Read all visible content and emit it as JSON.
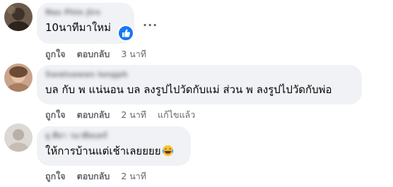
{
  "comments": [
    {
      "author": "Nas Phin Jirs",
      "text": "10นาทีมาใหม่",
      "like_label": "ถูกใจ",
      "reply_label": "ตอบกลับ",
      "time": "3 นาที",
      "edited": "",
      "reaction_icon": "like-icon",
      "more_icon": "ellipsis-icon",
      "more_label": "···",
      "colors": {
        "avatar": "#5a4a3c",
        "reaction": "#1877f2"
      }
    },
    {
      "author": "Swatsawan longph",
      "text": "บล กับ พ แน่นอน บล ลงรูปไปวัดกับแม่ ส่วน พ ลงรูปไปวัดกับพ่อ",
      "like_label": "ถูกใจ",
      "reply_label": "ตอบกลับ",
      "time": "2 นาที",
      "edited": "แก้ไขแล้ว",
      "colors": {
        "avatar": "#b98a6b"
      }
    },
    {
      "author": "ยุ ศีลา วนาศิลบทร์",
      "text": "ให้การบ้านแต่เช้าเลยยยย",
      "emoji_icon": "laughing-tears-emoji-icon",
      "like_label": "ถูกใจ",
      "reply_label": "ตอบกลับ",
      "time": "2 นาที",
      "edited": "",
      "colors": {
        "avatar": "#d6d2cf"
      }
    }
  ]
}
